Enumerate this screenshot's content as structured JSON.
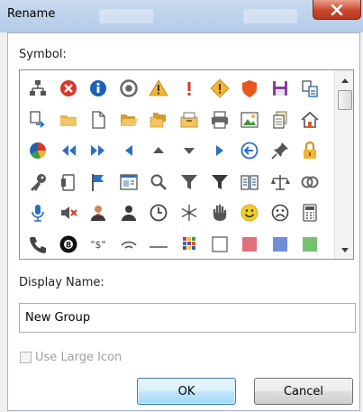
{
  "window": {
    "title": "Rename"
  },
  "symbol_label": "Symbol:",
  "symbols": [
    [
      "org-chart-icon",
      "error-circle-icon",
      "info-circle-icon",
      "target-circle-icon",
      "warning-triangle-icon",
      "exclamation-icon",
      "diamond-warning-icon",
      "shield-icon",
      "floppy-disk-icon",
      "move-doc-icon"
    ],
    [
      "doc-transfer-icon",
      "folder-icon",
      "blank-page-icon",
      "open-folder-icon",
      "folders-icon",
      "tray-icon",
      "printer-icon",
      "picture-icon",
      "documents-stack-icon",
      "home-icon"
    ],
    [
      "pie-chart-icon",
      "rewind-icon",
      "fast-forward-icon",
      "triangle-left-icon",
      "triangle-up-icon",
      "triangle-down-icon",
      "triangle-right-icon",
      "back-circle-icon",
      "pin-icon",
      "padlock-icon"
    ],
    [
      "key-icon",
      "card-device-icon",
      "flag-icon",
      "layout-window-icon",
      "magnifier-icon",
      "filter-icon",
      "filter-dark-icon",
      "book-icon",
      "scales-icon",
      "rings-icon"
    ],
    [
      "microphone-icon",
      "mute-speaker-icon",
      "person-a-icon",
      "person-b-icon",
      "clock-icon",
      "snowflake-icon",
      "hand-icon",
      "smiley-icon",
      "sad-face-icon",
      "calculator-icon"
    ],
    [
      "phone-icon",
      "eight-ball-icon",
      "dollar-text-icon",
      "wifi-arc-icon",
      "dash-line-icon",
      "color-grid-icon",
      "empty-square-icon",
      "pink-square-icon",
      "blue-square-icon",
      "green-square-icon"
    ]
  ],
  "display_name_label": "Display Name:",
  "display_name_value": "New Group",
  "large_icon_label": "Use Large Icon",
  "large_icon_checked": false,
  "ok_label": "OK",
  "cancel_label": "Cancel"
}
